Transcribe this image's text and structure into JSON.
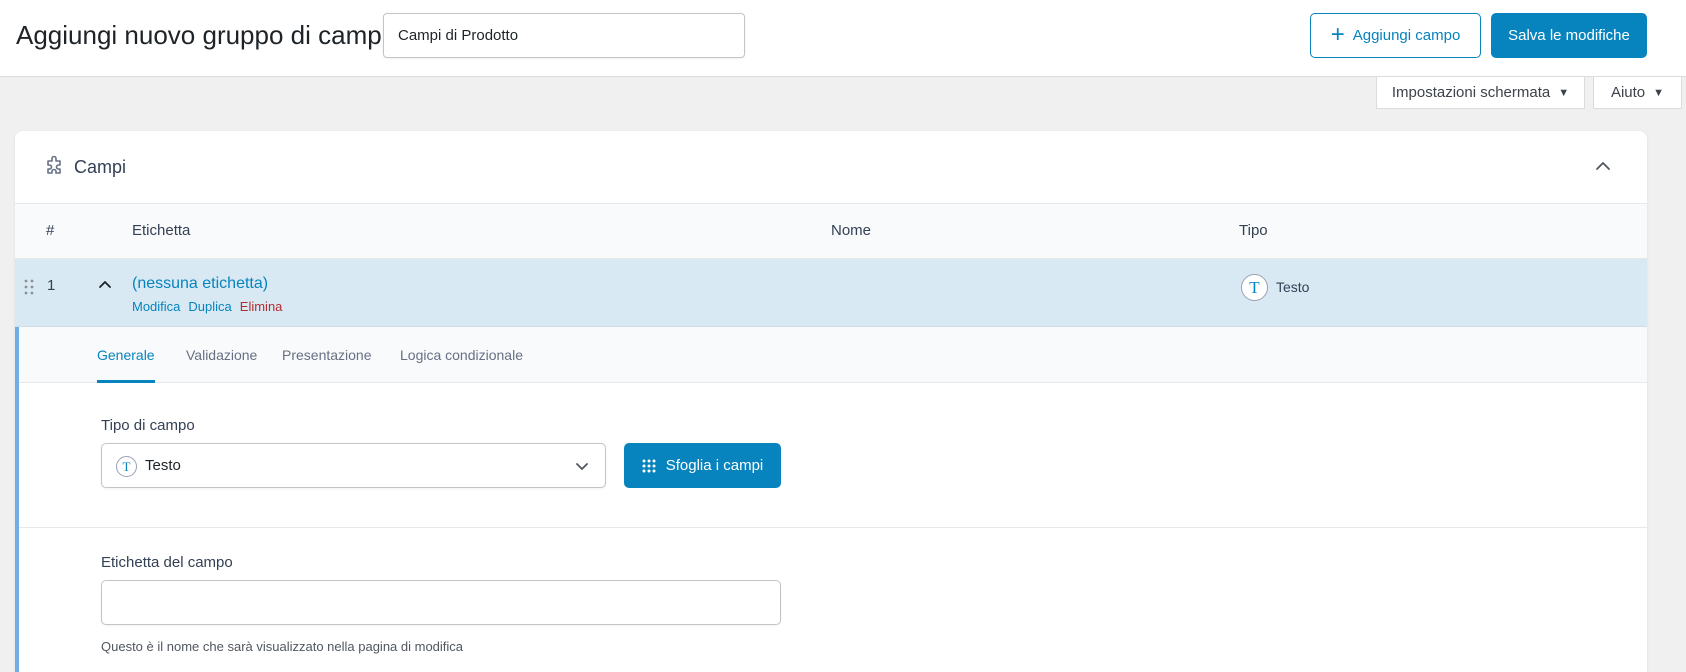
{
  "header": {
    "title": "Aggiungi nuovo gruppo di campi",
    "group_name_value": "Campi di Prodotto",
    "add_field_label": "Aggiungi campo",
    "save_label": "Salva le modifiche"
  },
  "screen_tabs": {
    "screen_options": "Impostazioni schermata",
    "help": "Aiuto"
  },
  "panel": {
    "title": "Campi",
    "columns": {
      "number": "#",
      "label": "Etichetta",
      "name": "Nome",
      "type": "Tipo"
    },
    "fields": [
      {
        "number": "1",
        "label": "(nessuna etichetta)",
        "actions": {
          "edit": "Modifica",
          "duplicate": "Duplica",
          "delete": "Elimina"
        },
        "type_icon": "T",
        "type": "Testo"
      }
    ],
    "settings_tabs": [
      "Generale",
      "Validazione",
      "Presentazione",
      "Logica condizionale"
    ],
    "field_type_label": "Tipo di campo",
    "field_type_value": "Testo",
    "field_type_icon": "T",
    "browse_label": "Sfoglia i campi",
    "field_label_label": "Etichetta del campo",
    "field_label_value": "",
    "field_label_help": "Questo è il nome che sarà visualizzato nella pagina di modifica"
  },
  "colors": {
    "accent": "#0783be",
    "row_highlight": "#d8e9f3",
    "delete": "#b32d2e",
    "page_bg": "#f0f0f1"
  }
}
